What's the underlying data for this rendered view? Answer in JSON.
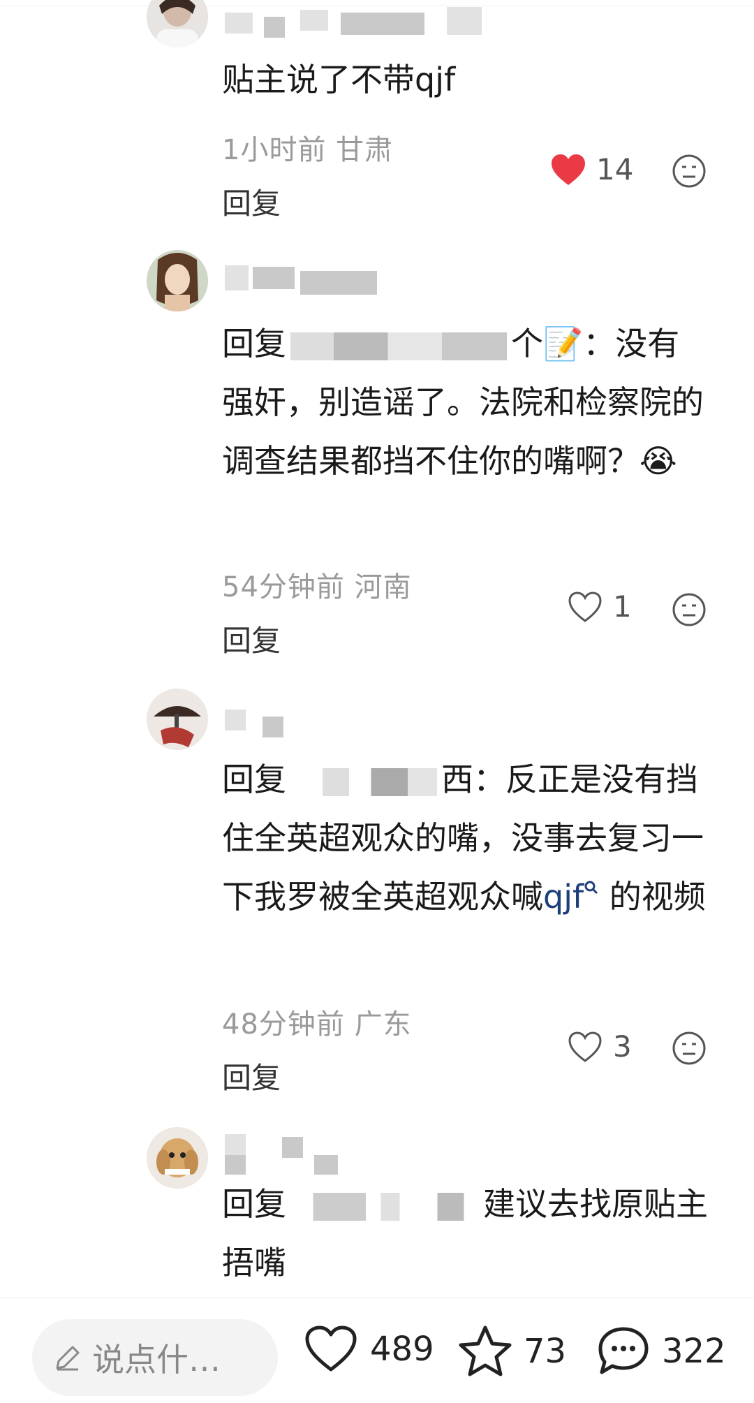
{
  "comments": [
    {
      "text": "贴主说了不带qjf",
      "time_location": "1小时前 甘肃",
      "reply_label": "回复",
      "likes": "14",
      "liked": true
    },
    {
      "reply_prefix": "回复",
      "reply_target_suffix": "个📝",
      "text": "：没有强奸，别造谣了。法院和检察院的调查结果都挡不住你的嘴啊？😭",
      "time_location": "54分钟前 河南",
      "reply_label": "回复",
      "likes": "1"
    },
    {
      "reply_prefix": "回复",
      "reply_target_suffix": "西",
      "text": "：反正是没有挡住全英超观众的嘴，没事去复习一下我罗被全英超观众喊",
      "link_text": "qjf",
      "text_tail": " 的视频",
      "time_location": "48分钟前 广东",
      "reply_label": "回复",
      "likes": "3"
    },
    {
      "reply_prefix": "回复",
      "text": "建议去找原贴主捂嘴"
    }
  ],
  "bottom_bar": {
    "input_placeholder": "说点什…",
    "likes_count": "489",
    "favorites_count": "73",
    "comments_count": "322"
  }
}
